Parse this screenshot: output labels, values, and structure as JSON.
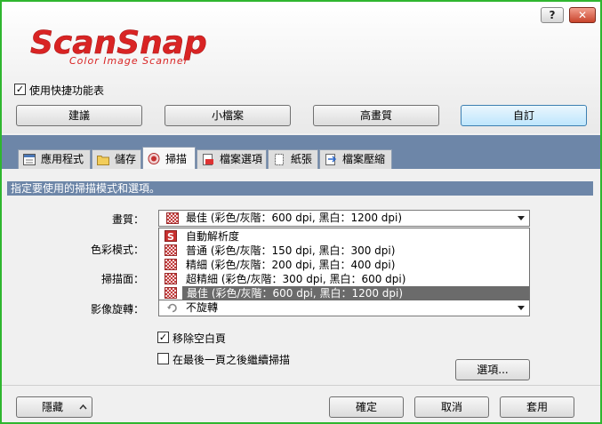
{
  "titlebar": {
    "help": "?",
    "close": "✕"
  },
  "logo": {
    "title": "ScanSnap",
    "subtitle": "Color Image Scanner",
    "color": "#d92424"
  },
  "quick_menu": {
    "label": "使用快捷功能表",
    "checked": true
  },
  "presets": [
    "建議",
    "小檔案",
    "高畫質",
    "自訂"
  ],
  "tabs": [
    {
      "label": "應用程式",
      "icon": "application-icon"
    },
    {
      "label": "儲存",
      "icon": "folder-icon"
    },
    {
      "label": "掃描",
      "icon": "scan-icon"
    },
    {
      "label": "檔案選項",
      "icon": "file-options-icon"
    },
    {
      "label": "紙張",
      "icon": "paper-icon"
    },
    {
      "label": "檔案壓縮",
      "icon": "compression-icon"
    }
  ],
  "active_tab": "掃描",
  "description": "指定要使用的掃描模式和選項。",
  "fields": {
    "quality_label": "畫質：",
    "quality_value": "最佳 (彩色/灰階：600 dpi, 黑白：1200 dpi)",
    "color_mode_label": "色彩模式：",
    "scan_side_label": "掃描面：",
    "rotation_label": "影像旋轉：",
    "rotation_value": "不旋轉"
  },
  "quality_options": [
    "自動解析度",
    "普通 (彩色/灰階：150 dpi, 黑白：300 dpi)",
    "精細 (彩色/灰階：200 dpi, 黑白：400 dpi)",
    "超精細 (彩色/灰階：300 dpi, 黑白：600 dpi)",
    "最佳 (彩色/灰階：600 dpi, 黑白：1200 dpi)"
  ],
  "checkboxes": {
    "remove_blank": {
      "label": "移除空白頁",
      "checked": true
    },
    "continue_scan": {
      "label": "在最後一頁之後繼續掃描",
      "checked": false
    }
  },
  "options_button": "選項...",
  "footer": {
    "hide": "隱藏",
    "ok": "確定",
    "cancel": "取消",
    "apply": "套用"
  }
}
